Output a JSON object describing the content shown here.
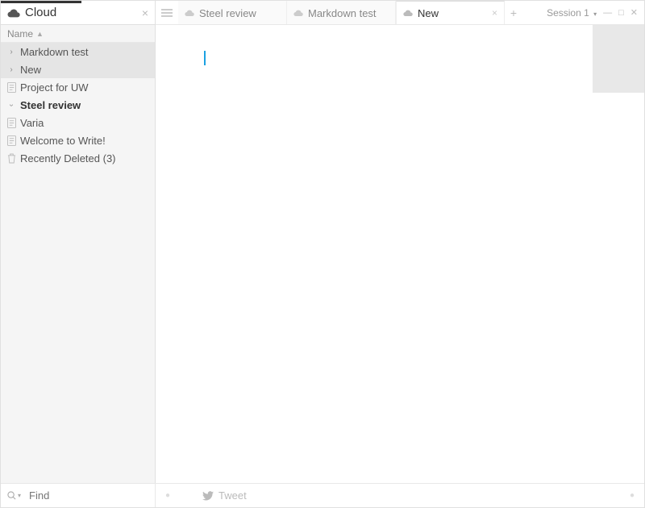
{
  "sidebar": {
    "title": "Cloud",
    "column_header": "Name",
    "items": [
      {
        "label": "Markdown test",
        "kind": "folder",
        "expanded": true,
        "selected": true,
        "bold": false
      },
      {
        "label": "New",
        "kind": "folder",
        "expanded": true,
        "selected": true,
        "bold": false
      },
      {
        "label": "Project for UW",
        "kind": "doc",
        "selected": false,
        "bold": false
      },
      {
        "label": "Steel review",
        "kind": "folder",
        "expanded": false,
        "selected": false,
        "bold": true
      },
      {
        "label": "Varia",
        "kind": "doc",
        "selected": false,
        "bold": false
      },
      {
        "label": "Welcome to Write!",
        "kind": "doc",
        "selected": false,
        "bold": false
      },
      {
        "label": "Recently Deleted (3)",
        "kind": "trash",
        "selected": false,
        "bold": false
      }
    ]
  },
  "tabs": [
    {
      "label": "Steel review",
      "active": false,
      "closable": false,
      "icon": "cloud"
    },
    {
      "label": "Markdown test",
      "active": false,
      "closable": false,
      "icon": "cloud"
    },
    {
      "label": "New",
      "active": true,
      "closable": true,
      "icon": "cloud"
    }
  ],
  "session": {
    "label": "Session 1"
  },
  "find": {
    "placeholder": "Find"
  },
  "footer": {
    "tweet_label": "Tweet"
  }
}
